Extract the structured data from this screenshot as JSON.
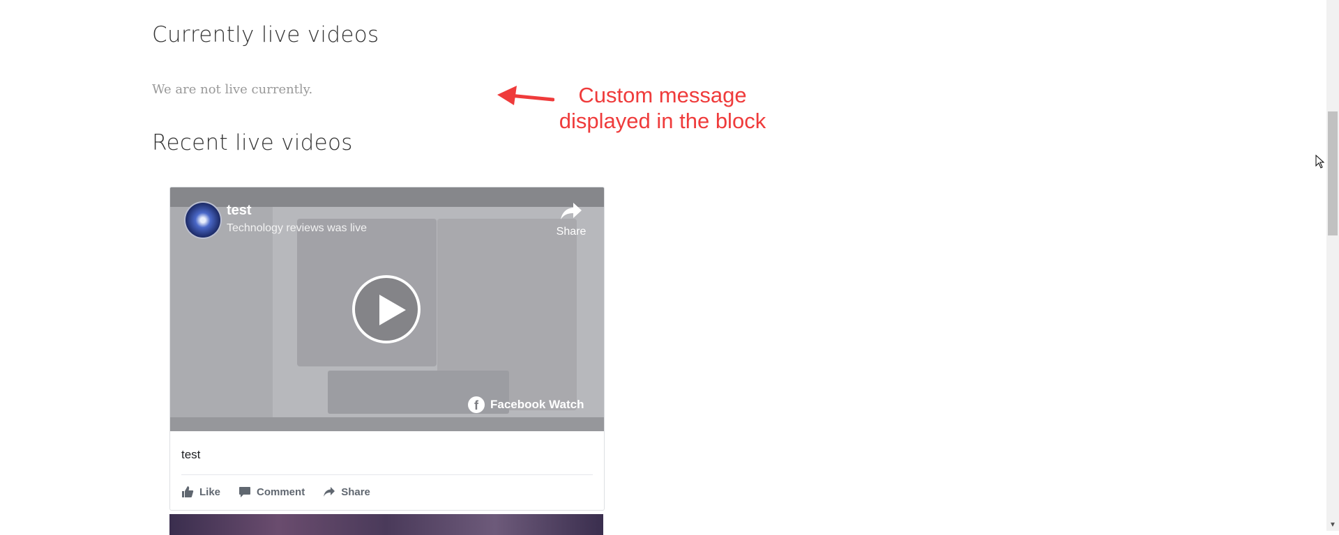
{
  "sections": {
    "current_heading": "Currently live videos",
    "current_message": "We are not live currently.",
    "recent_heading": "Recent live videos"
  },
  "annotation": {
    "text_line1": "Custom message",
    "text_line2": "displayed in the block",
    "color": "#ef3b3b"
  },
  "video": {
    "title": "test",
    "subtitle": "Technology reviews was live",
    "share_label": "Share",
    "watermark": "Facebook Watch",
    "caption": "test",
    "actions": {
      "like": "Like",
      "comment": "Comment",
      "share": "Share"
    }
  }
}
